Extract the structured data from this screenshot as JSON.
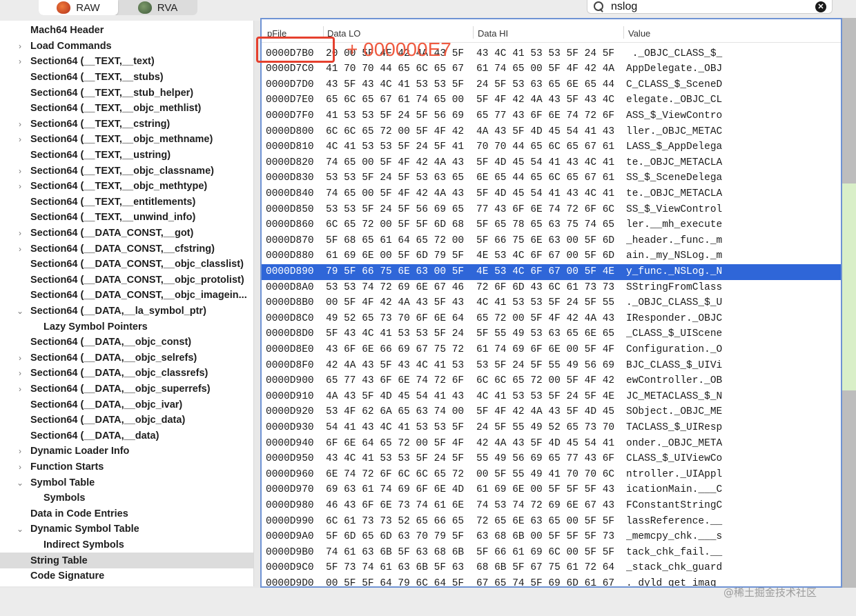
{
  "tabs": {
    "raw": "RAW",
    "rva": "RVA"
  },
  "search": {
    "value": "nslog"
  },
  "sidebar": {
    "items": [
      {
        "label": "Mach64 Header",
        "chev": "",
        "indent": 0
      },
      {
        "label": "Load Commands",
        "chev": "›",
        "indent": 0
      },
      {
        "label": "Section64 (__TEXT,__text)",
        "chev": "›",
        "indent": 0
      },
      {
        "label": "Section64 (__TEXT,__stubs)",
        "chev": "",
        "indent": 0
      },
      {
        "label": "Section64 (__TEXT,__stub_helper)",
        "chev": "",
        "indent": 0
      },
      {
        "label": "Section64 (__TEXT,__objc_methlist)",
        "chev": "",
        "indent": 0
      },
      {
        "label": "Section64 (__TEXT,__cstring)",
        "chev": "›",
        "indent": 0
      },
      {
        "label": "Section64 (__TEXT,__objc_methname)",
        "chev": "›",
        "indent": 0
      },
      {
        "label": "Section64 (__TEXT,__ustring)",
        "chev": "",
        "indent": 0
      },
      {
        "label": "Section64 (__TEXT,__objc_classname)",
        "chev": "›",
        "indent": 0
      },
      {
        "label": "Section64 (__TEXT,__objc_methtype)",
        "chev": "›",
        "indent": 0
      },
      {
        "label": "Section64 (__TEXT,__entitlements)",
        "chev": "",
        "indent": 0
      },
      {
        "label": "Section64 (__TEXT,__unwind_info)",
        "chev": "",
        "indent": 0
      },
      {
        "label": "Section64 (__DATA_CONST,__got)",
        "chev": "›",
        "indent": 0
      },
      {
        "label": "Section64 (__DATA_CONST,__cfstring)",
        "chev": "›",
        "indent": 0
      },
      {
        "label": "Section64 (__DATA_CONST,__objc_classlist)",
        "chev": "",
        "indent": 0
      },
      {
        "label": "Section64 (__DATA_CONST,__objc_protolist)",
        "chev": "",
        "indent": 0
      },
      {
        "label": "Section64 (__DATA_CONST,__objc_imagein...",
        "chev": "",
        "indent": 0
      },
      {
        "label": "Section64 (__DATA,__la_symbol_ptr)",
        "chev": "⌄",
        "indent": 0
      },
      {
        "label": "Lazy Symbol Pointers",
        "chev": "",
        "indent": 1
      },
      {
        "label": "Section64 (__DATA,__objc_const)",
        "chev": "",
        "indent": 0
      },
      {
        "label": "Section64 (__DATA,__objc_selrefs)",
        "chev": "›",
        "indent": 0
      },
      {
        "label": "Section64 (__DATA,__objc_classrefs)",
        "chev": "›",
        "indent": 0
      },
      {
        "label": "Section64 (__DATA,__objc_superrefs)",
        "chev": "›",
        "indent": 0
      },
      {
        "label": "Section64 (__DATA,__objc_ivar)",
        "chev": "",
        "indent": 0
      },
      {
        "label": "Section64 (__DATA,__objc_data)",
        "chev": "",
        "indent": 0
      },
      {
        "label": "Section64 (__DATA,__data)",
        "chev": "",
        "indent": 0
      },
      {
        "label": "Dynamic Loader Info",
        "chev": "›",
        "indent": 0
      },
      {
        "label": "Function Starts",
        "chev": "›",
        "indent": 0
      },
      {
        "label": "Symbol Table",
        "chev": "⌄",
        "indent": 0
      },
      {
        "label": "Symbols",
        "chev": "",
        "indent": 1
      },
      {
        "label": "Data in Code Entries",
        "chev": "",
        "indent": 0
      },
      {
        "label": "Dynamic Symbol Table",
        "chev": "⌄",
        "indent": 0
      },
      {
        "label": "Indirect Symbols",
        "chev": "",
        "indent": 1
      },
      {
        "label": "String Table",
        "chev": "",
        "indent": 0,
        "selected": true
      },
      {
        "label": "Code Signature",
        "chev": "",
        "indent": 0
      }
    ]
  },
  "table": {
    "columns": [
      "pFile",
      "Data LO",
      "Data HI",
      "Value"
    ],
    "rows": [
      [
        "0000D7B0",
        "20 00 5F 4F 42 4A 43 5F",
        "43 4C 41 53 53 5F 24 5F",
        " ._OBJC_CLASS_$_"
      ],
      [
        "0000D7C0",
        "41 70 70 44 65 6C 65 67",
        "61 74 65 00 5F 4F 42 4A",
        "AppDelegate._OBJ"
      ],
      [
        "0000D7D0",
        "43 5F 43 4C 41 53 53 5F",
        "24 5F 53 63 65 6E 65 44",
        "C_CLASS_$_SceneD"
      ],
      [
        "0000D7E0",
        "65 6C 65 67 61 74 65 00",
        "5F 4F 42 4A 43 5F 43 4C",
        "elegate._OBJC_CL"
      ],
      [
        "0000D7F0",
        "41 53 53 5F 24 5F 56 69",
        "65 77 43 6F 6E 74 72 6F",
        "ASS_$_ViewContro"
      ],
      [
        "0000D800",
        "6C 6C 65 72 00 5F 4F 42",
        "4A 43 5F 4D 45 54 41 43",
        "ller._OBJC_METAC"
      ],
      [
        "0000D810",
        "4C 41 53 53 5F 24 5F 41",
        "70 70 44 65 6C 65 67 61",
        "LASS_$_AppDelega"
      ],
      [
        "0000D820",
        "74 65 00 5F 4F 42 4A 43",
        "5F 4D 45 54 41 43 4C 41",
        "te._OBJC_METACLA"
      ],
      [
        "0000D830",
        "53 53 5F 24 5F 53 63 65",
        "6E 65 44 65 6C 65 67 61",
        "SS_$_SceneDelega"
      ],
      [
        "0000D840",
        "74 65 00 5F 4F 42 4A 43",
        "5F 4D 45 54 41 43 4C 41",
        "te._OBJC_METACLA"
      ],
      [
        "0000D850",
        "53 53 5F 24 5F 56 69 65",
        "77 43 6F 6E 74 72 6F 6C",
        "SS_$_ViewControl"
      ],
      [
        "0000D860",
        "6C 65 72 00 5F 5F 6D 68",
        "5F 65 78 65 63 75 74 65",
        "ler.__mh_execute"
      ],
      [
        "0000D870",
        "5F 68 65 61 64 65 72 00",
        "5F 66 75 6E 63 00 5F 6D",
        "_header._func._m"
      ],
      [
        "0000D880",
        "61 69 6E 00 5F 6D 79 5F",
        "4E 53 4C 6F 67 00 5F 6D",
        "ain._my_NSLog._m"
      ],
      [
        "0000D890",
        "79 5F 66 75 6E 63 00 5F",
        "4E 53 4C 6F 67 00 5F 4E",
        "y_func._NSLog._N"
      ],
      [
        "0000D8A0",
        "53 53 74 72 69 6E 67 46",
        "72 6F 6D 43 6C 61 73 73",
        "SStringFromClass"
      ],
      [
        "0000D8B0",
        "00 5F 4F 42 4A 43 5F 43",
        "4C 41 53 53 5F 24 5F 55",
        "._OBJC_CLASS_$_U"
      ],
      [
        "0000D8C0",
        "49 52 65 73 70 6F 6E 64",
        "65 72 00 5F 4F 42 4A 43",
        "IResponder._OBJC"
      ],
      [
        "0000D8D0",
        "5F 43 4C 41 53 53 5F 24",
        "5F 55 49 53 63 65 6E 65",
        "_CLASS_$_UIScene"
      ],
      [
        "0000D8E0",
        "43 6F 6E 66 69 67 75 72",
        "61 74 69 6F 6E 00 5F 4F",
        "Configuration._O"
      ],
      [
        "0000D8F0",
        "42 4A 43 5F 43 4C 41 53",
        "53 5F 24 5F 55 49 56 69",
        "BJC_CLASS_$_UIVi"
      ],
      [
        "0000D900",
        "65 77 43 6F 6E 74 72 6F",
        "6C 6C 65 72 00 5F 4F 42",
        "ewController._OB"
      ],
      [
        "0000D910",
        "4A 43 5F 4D 45 54 41 43",
        "4C 41 53 53 5F 24 5F 4E",
        "JC_METACLASS_$_N"
      ],
      [
        "0000D920",
        "53 4F 62 6A 65 63 74 00",
        "5F 4F 42 4A 43 5F 4D 45",
        "SObject._OBJC_ME"
      ],
      [
        "0000D930",
        "54 41 43 4C 41 53 53 5F",
        "24 5F 55 49 52 65 73 70",
        "TACLASS_$_UIResp"
      ],
      [
        "0000D940",
        "6F 6E 64 65 72 00 5F 4F",
        "42 4A 43 5F 4D 45 54 41",
        "onder._OBJC_META"
      ],
      [
        "0000D950",
        "43 4C 41 53 53 5F 24 5F",
        "55 49 56 69 65 77 43 6F",
        "CLASS_$_UIViewCo"
      ],
      [
        "0000D960",
        "6E 74 72 6F 6C 6C 65 72",
        "00 5F 55 49 41 70 70 6C",
        "ntroller._UIAppl"
      ],
      [
        "0000D970",
        "69 63 61 74 69 6F 6E 4D",
        "61 69 6E 00 5F 5F 5F 43",
        "icationMain.___C"
      ],
      [
        "0000D980",
        "46 43 6F 6E 73 74 61 6E",
        "74 53 74 72 69 6E 67 43",
        "FConstantStringC"
      ],
      [
        "0000D990",
        "6C 61 73 73 52 65 66 65",
        "72 65 6E 63 65 00 5F 5F",
        "lassReference.__"
      ],
      [
        "0000D9A0",
        "5F 6D 65 6D 63 70 79 5F",
        "63 68 6B 00 5F 5F 5F 73",
        "_memcpy_chk.___s"
      ],
      [
        "0000D9B0",
        "74 61 63 6B 5F 63 68 6B",
        "5F 66 61 69 6C 00 5F 5F",
        "tack_chk_fail.__"
      ],
      [
        "0000D9C0",
        "5F 73 74 61 63 6B 5F 63",
        "68 6B 5F 67 75 61 72 64",
        "_stack_chk_guard"
      ],
      [
        "0000D9D0",
        "00 5F 5F 64 79 6C 64 5F",
        "67 65 74 5F 69 6D 61 67",
        "._dyld_get_imag"
      ]
    ],
    "selected_row": 14
  },
  "annotation": {
    "text": "+ 000000E7",
    "color": "#e5402e"
  },
  "watermark": "@稀土掘金技术社区",
  "colors": {
    "selection": "#2f66d8",
    "panel_border": "#6f93d4"
  }
}
